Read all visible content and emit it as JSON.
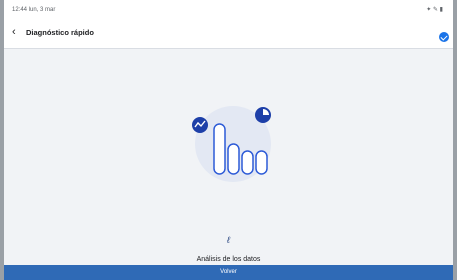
{
  "status": {
    "left": "12:44 lun, 3 mar",
    "right": "✦ ✎ ▮"
  },
  "appbar": {
    "back": "‹",
    "title": "Diagnóstico rápido"
  },
  "analysis": {
    "hint": "ℓ",
    "caption": "Análisis de los datos"
  },
  "bottom": {
    "label": "Volver"
  },
  "colors": {
    "accent": "#1a73e8",
    "nav_blue": "#2f6ab6"
  }
}
